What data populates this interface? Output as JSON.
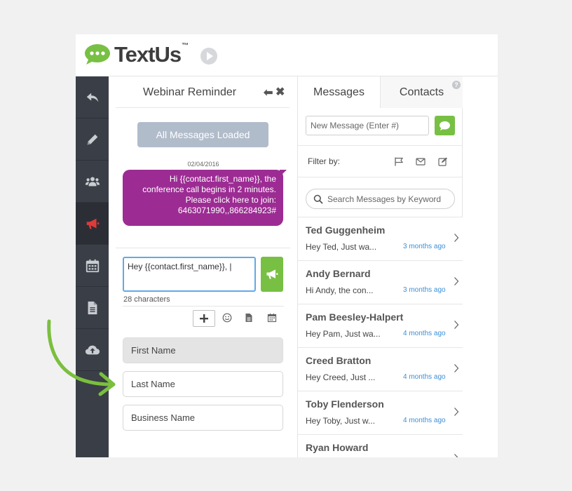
{
  "colors": {
    "green": "#78c043",
    "purple": "#9c2c93",
    "nav_bg": "#3a3f47",
    "nav_active_icon": "#e03a3a",
    "link_blue": "#3b8fd6",
    "arrow": "#7bbf3e"
  },
  "brand": {
    "name": "TextUs",
    "tm": "™"
  },
  "nav": {
    "items": [
      {
        "icon": "reply-icon"
      },
      {
        "icon": "pencil-icon"
      },
      {
        "icon": "users-icon"
      },
      {
        "icon": "megaphone-icon",
        "active": true
      },
      {
        "icon": "calendar-icon"
      },
      {
        "icon": "document-icon"
      },
      {
        "icon": "cloud-upload-icon"
      }
    ]
  },
  "campaign": {
    "title": "Webinar Reminder",
    "back_glyph": "⬅",
    "close_glyph": "✖",
    "loaded_label": "All Messages Loaded",
    "message": {
      "date": "02/04/2016",
      "body": "Hi {{contact.first_name}}, the conference call begins in 2 minutes. Please click here to join: 6463071990,,866284923#"
    },
    "compose": {
      "value": "Hey {{contact.first_name}}, |",
      "char_count": "28 characters"
    },
    "fields": [
      "First Name",
      "Last Name",
      "Business Name"
    ]
  },
  "messages_panel": {
    "tabs": [
      "Messages",
      "Contacts"
    ],
    "help": "?",
    "new_message_placeholder": "New Message (Enter #)",
    "filter_label": "Filter by:",
    "search_placeholder": "Search Messages by Keyword",
    "contacts": [
      {
        "name": "Ted Guggenheim",
        "preview": "Hey Ted, Just wa...",
        "time": "3 months ago"
      },
      {
        "name": "Andy Bernard",
        "preview": "Hi Andy, the con...",
        "time": "3 months ago"
      },
      {
        "name": "Pam Beesley-Halpert",
        "preview": "Hey Pam, Just wa...",
        "time": "4 months ago"
      },
      {
        "name": "Creed Bratton",
        "preview": "Hey Creed, Just ...",
        "time": "4 months ago"
      },
      {
        "name": "Toby Flenderson",
        "preview": "Hey Toby, Just w...",
        "time": "4 months ago"
      },
      {
        "name": "Ryan Howard",
        "preview": "",
        "time": ""
      }
    ]
  }
}
